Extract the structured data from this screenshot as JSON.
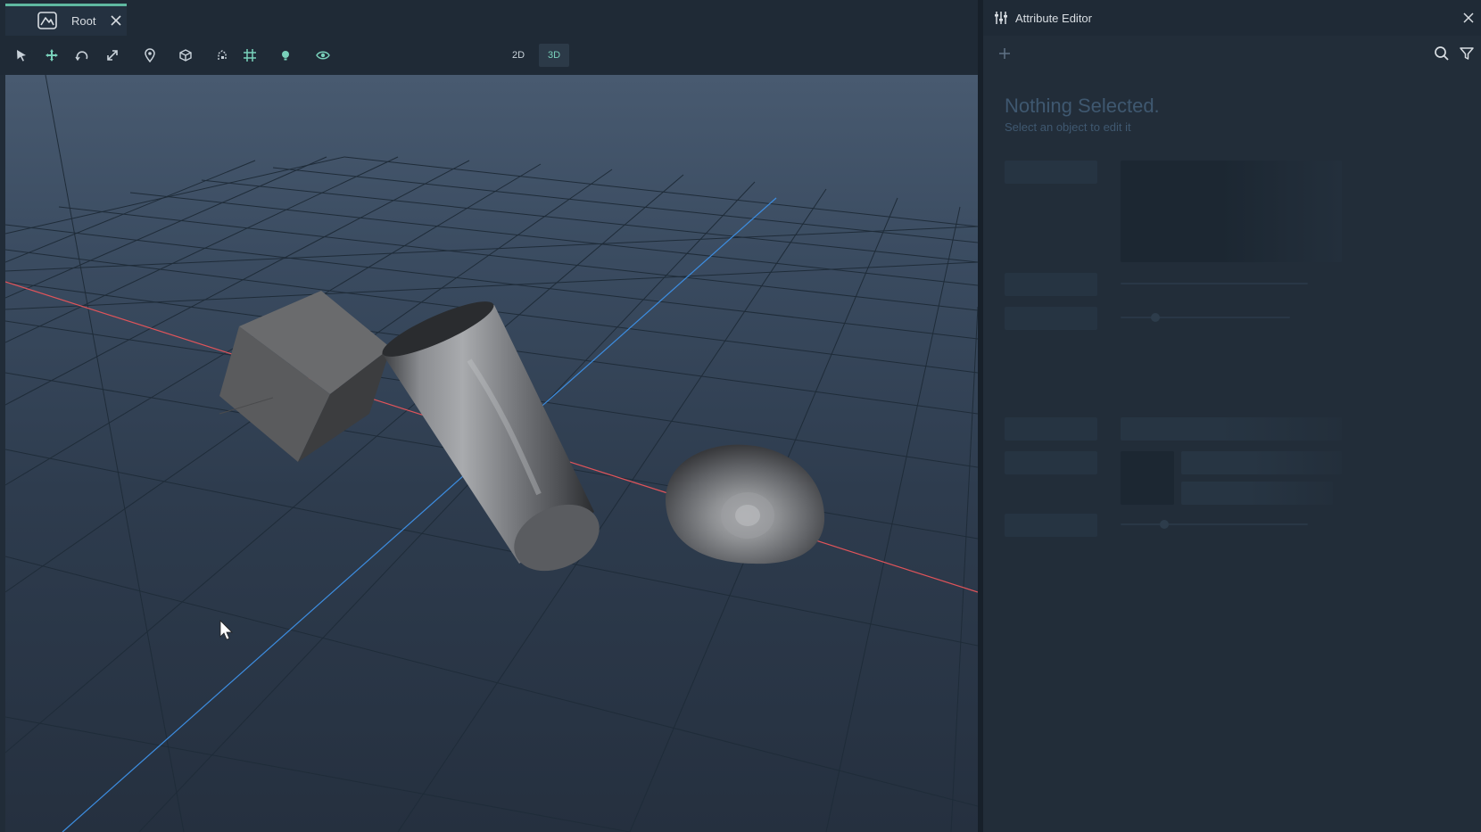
{
  "tab": {
    "label": "Root"
  },
  "toolbar": {
    "tools": [
      "select-icon",
      "move-icon",
      "rotate-icon",
      "scale-icon",
      "pin-icon",
      "camera-icon",
      "snap-icon",
      "grid-icon",
      "light-icon",
      "visibility-icon"
    ],
    "mode_2d": "2D",
    "mode_3d": "3D",
    "active_mode": "3D",
    "accent": "#5fb8a0"
  },
  "attribute_editor": {
    "title": "Attribute Editor",
    "empty_title": "Nothing Selected.",
    "empty_subtitle": "Select an object to edit it"
  },
  "scene": {
    "objects": [
      "cube",
      "cylinder",
      "sphere"
    ],
    "axis_colors": {
      "x": "#e0545a",
      "z": "#3d8de0"
    },
    "grid_color": "#20303f"
  }
}
